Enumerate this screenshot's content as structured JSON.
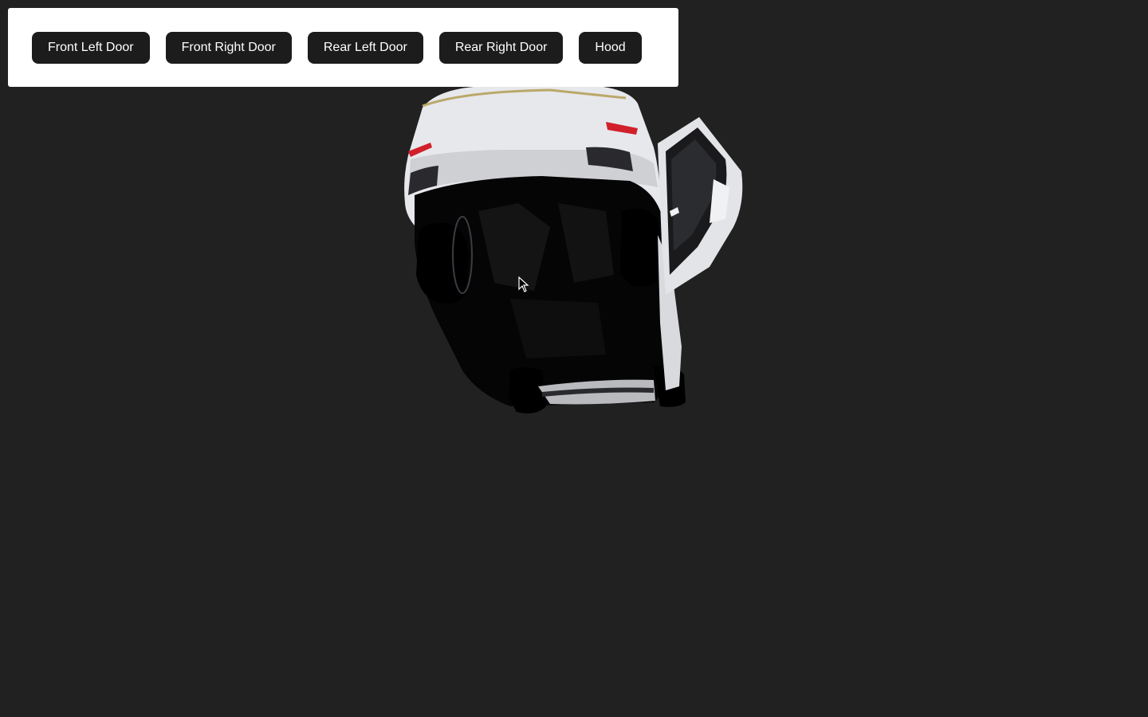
{
  "toolbar": {
    "buttons": [
      {
        "label": "Front Left Door"
      },
      {
        "label": "Front Right Door"
      },
      {
        "label": "Rear Left Door"
      },
      {
        "label": "Rear Right Door"
      },
      {
        "label": "Hood"
      }
    ]
  },
  "scene": {
    "background_color": "#212121",
    "object": "car-model",
    "state": "right door open, upside-down view"
  },
  "colors": {
    "button_bg": "#1c1c1c",
    "button_text": "#ffffff",
    "panel_bg": "#ffffff",
    "car_body": "#e8e8ea",
    "tail_light": "#d1202a"
  }
}
